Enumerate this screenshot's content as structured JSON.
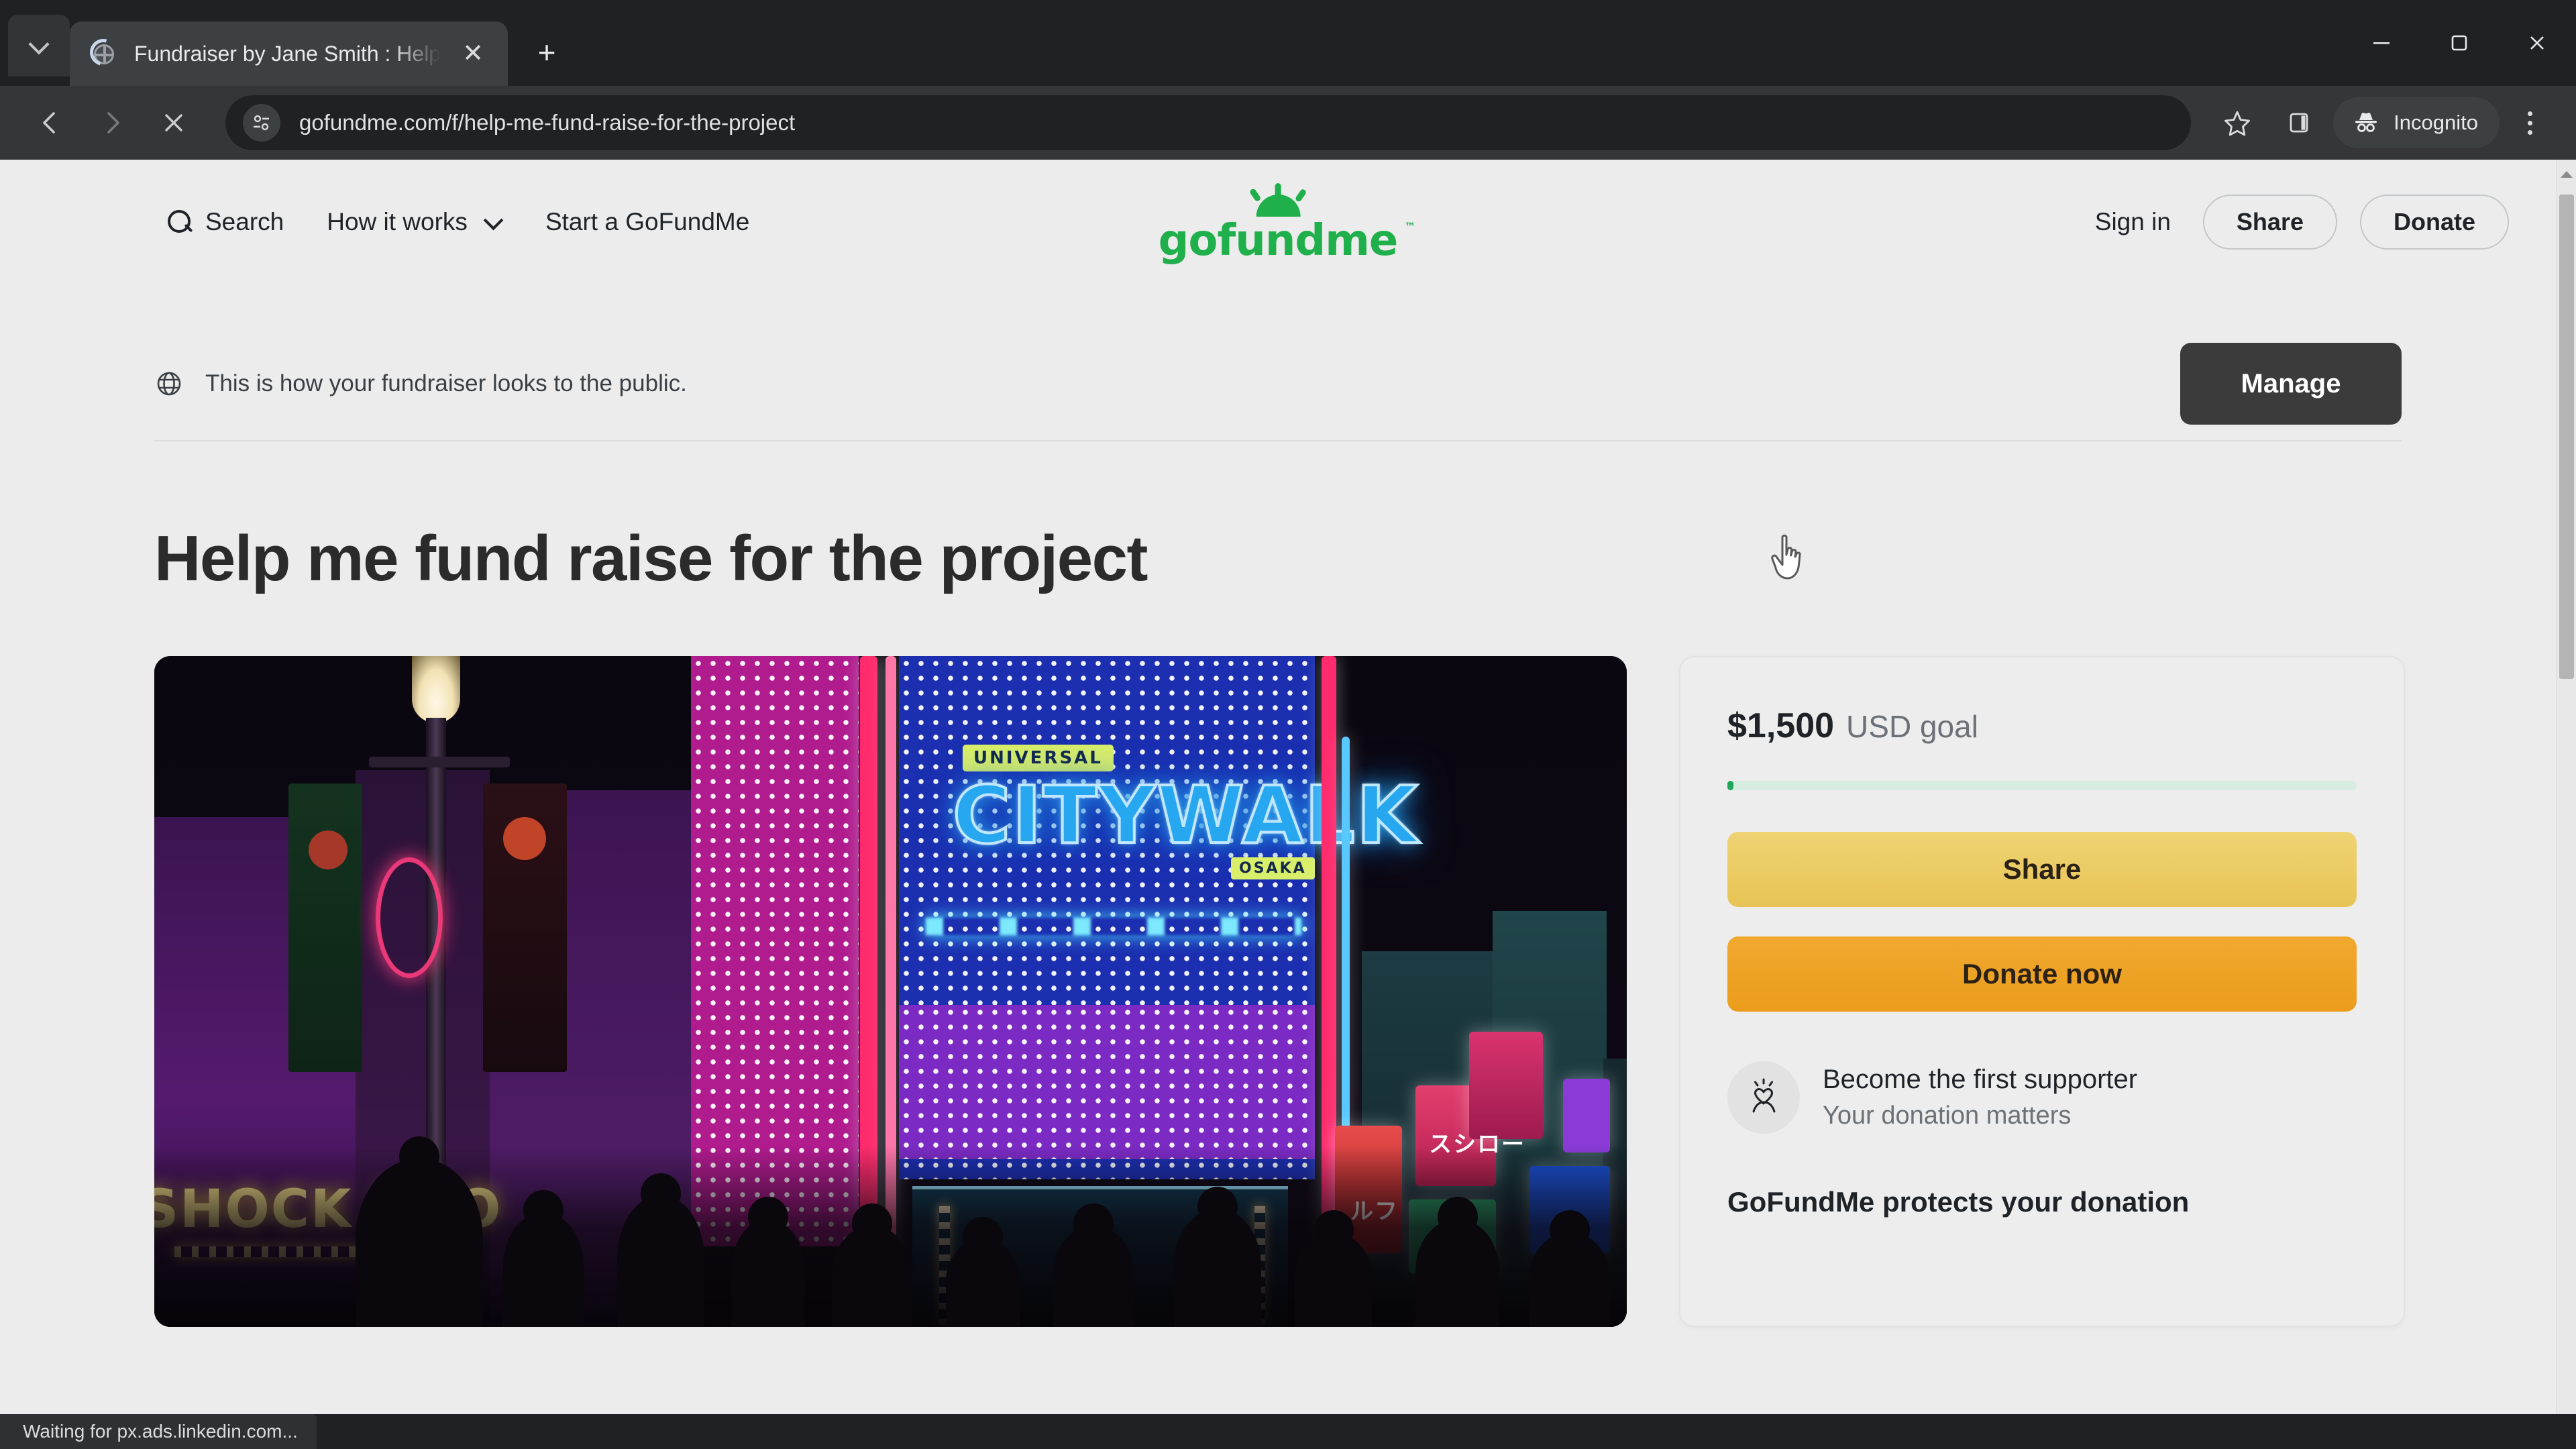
{
  "browser": {
    "tab": {
      "title": "Fundraiser by Jane Smith : Help",
      "favicon_icon": "globe-favicon",
      "loading_icon": "loading-spinner",
      "close_icon": "close-icon"
    },
    "tab_search_icon": "chevron-down-icon",
    "new_tab_icon": "plus-icon",
    "window_controls": {
      "minimize_icon": "minimize-icon",
      "maximize_icon": "maximize-restore-icon",
      "close_icon": "window-close-icon"
    },
    "toolbar": {
      "back_icon": "back-arrow-icon",
      "forward_icon": "forward-arrow-icon",
      "stop_icon": "stop-loading-icon",
      "site_info_icon": "site-settings-icon",
      "url": "gofundme.com/f/help-me-fund-raise-for-the-project",
      "bookmark_icon": "star-icon",
      "side_panel_icon": "side-panel-icon",
      "incognito_label": "Incognito",
      "incognito_icon": "incognito-hat-icon",
      "menu_icon": "kebab-menu-icon"
    },
    "status_text": "Waiting for px.ads.linkedin.com..."
  },
  "site": {
    "nav": {
      "search_label": "Search",
      "search_icon": "search-icon",
      "how_it_works_label": "How it works",
      "how_it_works_icon": "chevron-down-icon",
      "start_label": "Start a GoFundMe",
      "sign_in_label": "Sign in",
      "share_label": "Share",
      "donate_label": "Donate"
    },
    "logo": {
      "wordmark": "gofundme",
      "trademark": "™",
      "icon": "sunrise-icon",
      "color": "#20b04b"
    },
    "notice": {
      "icon": "globe-icon",
      "text": "This is how your fundraiser looks to the public.",
      "manage_label": "Manage"
    },
    "fundraiser": {
      "title": "Help me fund raise for the project",
      "hero_image_alt": "Universal CityWalk Osaka neon street at night",
      "hero_signs": {
        "universal": "UNIVERSAL",
        "citywalk": "CITYWALK",
        "osaka": "OSAKA",
        "shop": "SHO"
      }
    },
    "donation_panel": {
      "goal_amount": "$1,500",
      "goal_suffix": "USD goal",
      "progress_percent": 1,
      "share_label": "Share",
      "donate_label": "Donate now",
      "supporter_icon": "heart-hand-icon",
      "supporter_title": "Become the first supporter",
      "supporter_subtitle": "Your donation matters",
      "protects_text": "GoFundMe protects your donation",
      "accent_share": "#e8c455",
      "accent_donate": "#eb9c1c",
      "progress_color": "#1ea75b"
    }
  }
}
